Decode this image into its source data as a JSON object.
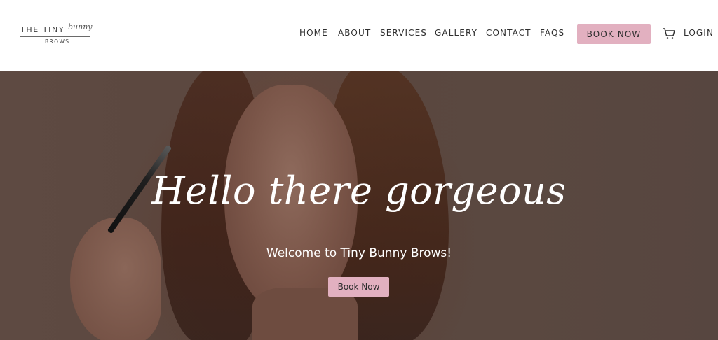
{
  "logo": {
    "line1": "THE TINY",
    "script": "bunny",
    "line2": "BROWS"
  },
  "nav": {
    "items": [
      {
        "label": "HOME"
      },
      {
        "label": "ABOUT"
      },
      {
        "label": "SERVICES"
      },
      {
        "label": "GALLERY"
      },
      {
        "label": "CONTACT"
      },
      {
        "label": "FAQS"
      }
    ],
    "book_label": "BOOK NOW",
    "login_label": "LOGIN",
    "cart_icon": "cart-icon"
  },
  "hero": {
    "heading": "Hello there gorgeous",
    "subheading": "Welcome to Tiny Bunny Brows!",
    "button_label": "Book Now"
  },
  "colors": {
    "accent": "#e2b0c0",
    "text": "#2e2e2e",
    "hero_overlay": "#5a463e"
  }
}
